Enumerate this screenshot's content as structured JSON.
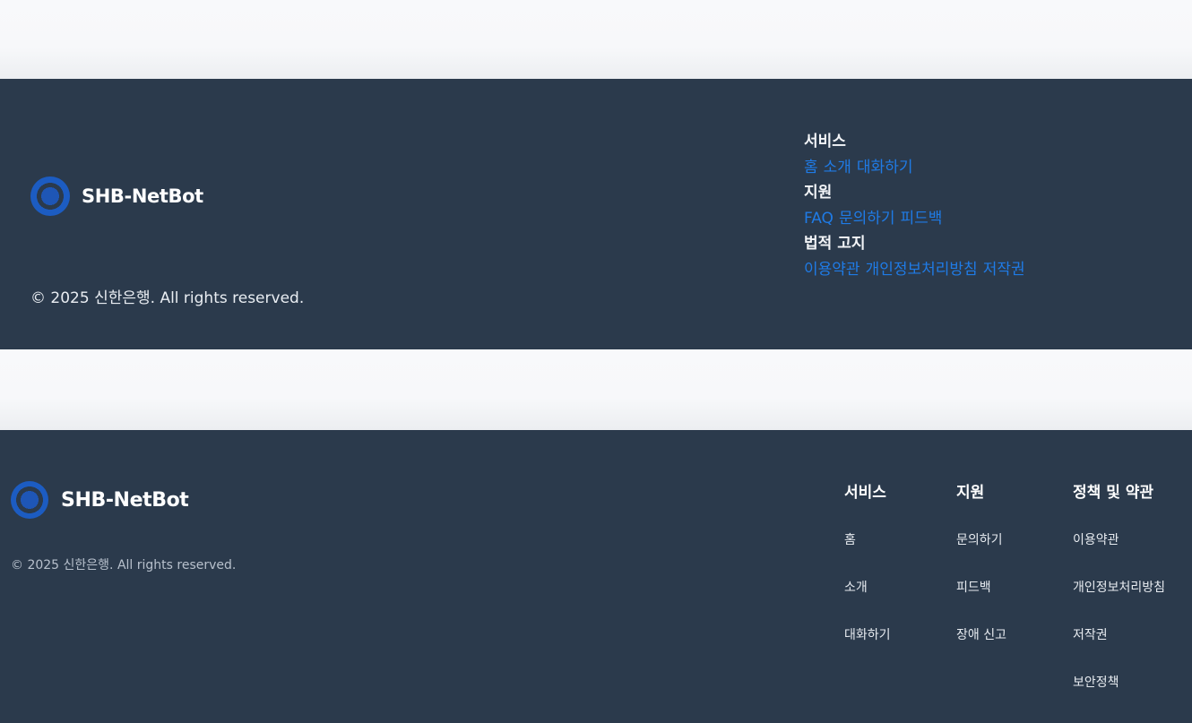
{
  "footer_a": {
    "brand": "SHB-NetBot",
    "copyright": "© 2025 신한은행. All rights reserved.",
    "sections": [
      {
        "heading": "서비스",
        "links": [
          "홈",
          "소개",
          "대화하기"
        ]
      },
      {
        "heading": "지원",
        "links": [
          "FAQ",
          "문의하기",
          "피드백"
        ]
      },
      {
        "heading": "법적 고지",
        "links": [
          "이용약관",
          "개인정보처리방침",
          "저작권"
        ]
      }
    ],
    "link_color": "#1f7be6"
  },
  "footer_b": {
    "brand": "SHB-NetBot",
    "copyright": "© 2025 신한은행. All rights reserved.",
    "columns": [
      {
        "heading": "서비스",
        "links": [
          "홈",
          "소개",
          "대화하기"
        ]
      },
      {
        "heading": "지원",
        "links": [
          "문의하기",
          "피드백",
          "장애 신고"
        ]
      },
      {
        "heading": "정책 및 약관",
        "links": [
          "이용약관",
          "개인정보처리방침",
          "저작권",
          "보안정책"
        ]
      }
    ]
  },
  "theme": {
    "footer_bg": "#2b3a4c",
    "brand_accent": "#1e56b6"
  },
  "icons": {
    "logo": "target-ring-logo-icon"
  }
}
